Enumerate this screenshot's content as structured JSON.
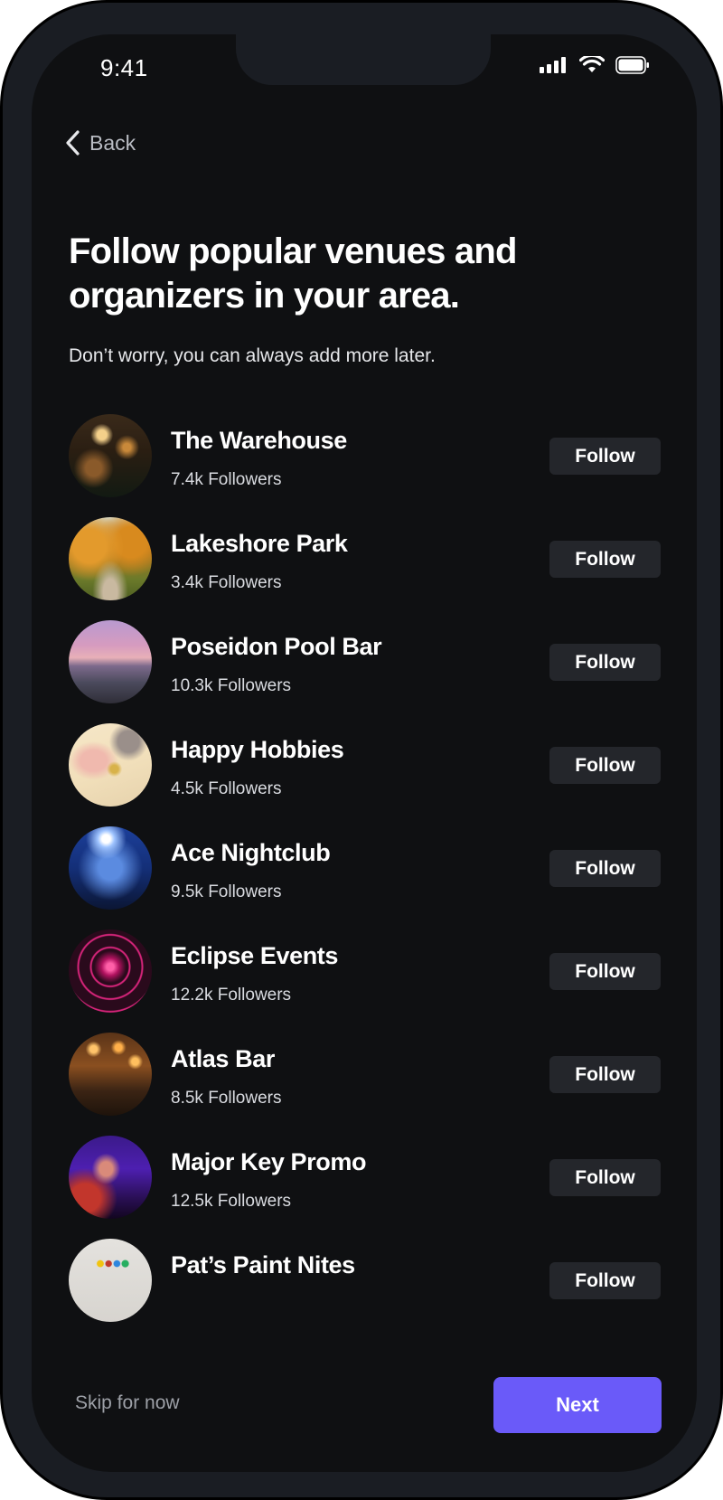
{
  "status_bar": {
    "time": "9:41"
  },
  "nav": {
    "back_label": "Back"
  },
  "page": {
    "title": "Follow popular venues and organizers in your area.",
    "subtitle": "Don’t worry, you can always add more later."
  },
  "organizers": [
    {
      "name": "The Warehouse",
      "followers": "7.4k Followers",
      "follow_label": "Follow",
      "avatar_icon": "bar-interior-photo"
    },
    {
      "name": "Lakeshore Park",
      "followers": "3.4k Followers",
      "follow_label": "Follow",
      "avatar_icon": "autumn-park-photo"
    },
    {
      "name": "Poseidon Pool Bar",
      "followers": "10.3k Followers",
      "follow_label": "Follow",
      "avatar_icon": "sunset-pool-photo"
    },
    {
      "name": "Happy Hobbies",
      "followers": "4.5k Followers",
      "follow_label": "Follow",
      "avatar_icon": "crafts-table-photo"
    },
    {
      "name": "Ace Nightclub",
      "followers": "9.5k Followers",
      "follow_label": "Follow",
      "avatar_icon": "nightclub-fog-photo"
    },
    {
      "name": "Eclipse Events",
      "followers": "12.2k Followers",
      "follow_label": "Follow",
      "avatar_icon": "neon-tunnel-photo"
    },
    {
      "name": "Atlas Bar",
      "followers": "8.5k Followers",
      "follow_label": "Follow",
      "avatar_icon": "restaurant-bar-photo"
    },
    {
      "name": "Major Key Promo",
      "followers": "12.5k Followers",
      "follow_label": "Follow",
      "avatar_icon": "dj-purple-light-photo"
    },
    {
      "name": "Pat’s Paint Nites",
      "followers": "",
      "follow_label": "Follow",
      "avatar_icon": "paint-palette-photo"
    }
  ],
  "footer": {
    "skip_label": "Skip for now",
    "next_label": "Next"
  },
  "colors": {
    "accent": "#6a5af9",
    "background": "#0f1012",
    "button_bg": "#24262b"
  }
}
